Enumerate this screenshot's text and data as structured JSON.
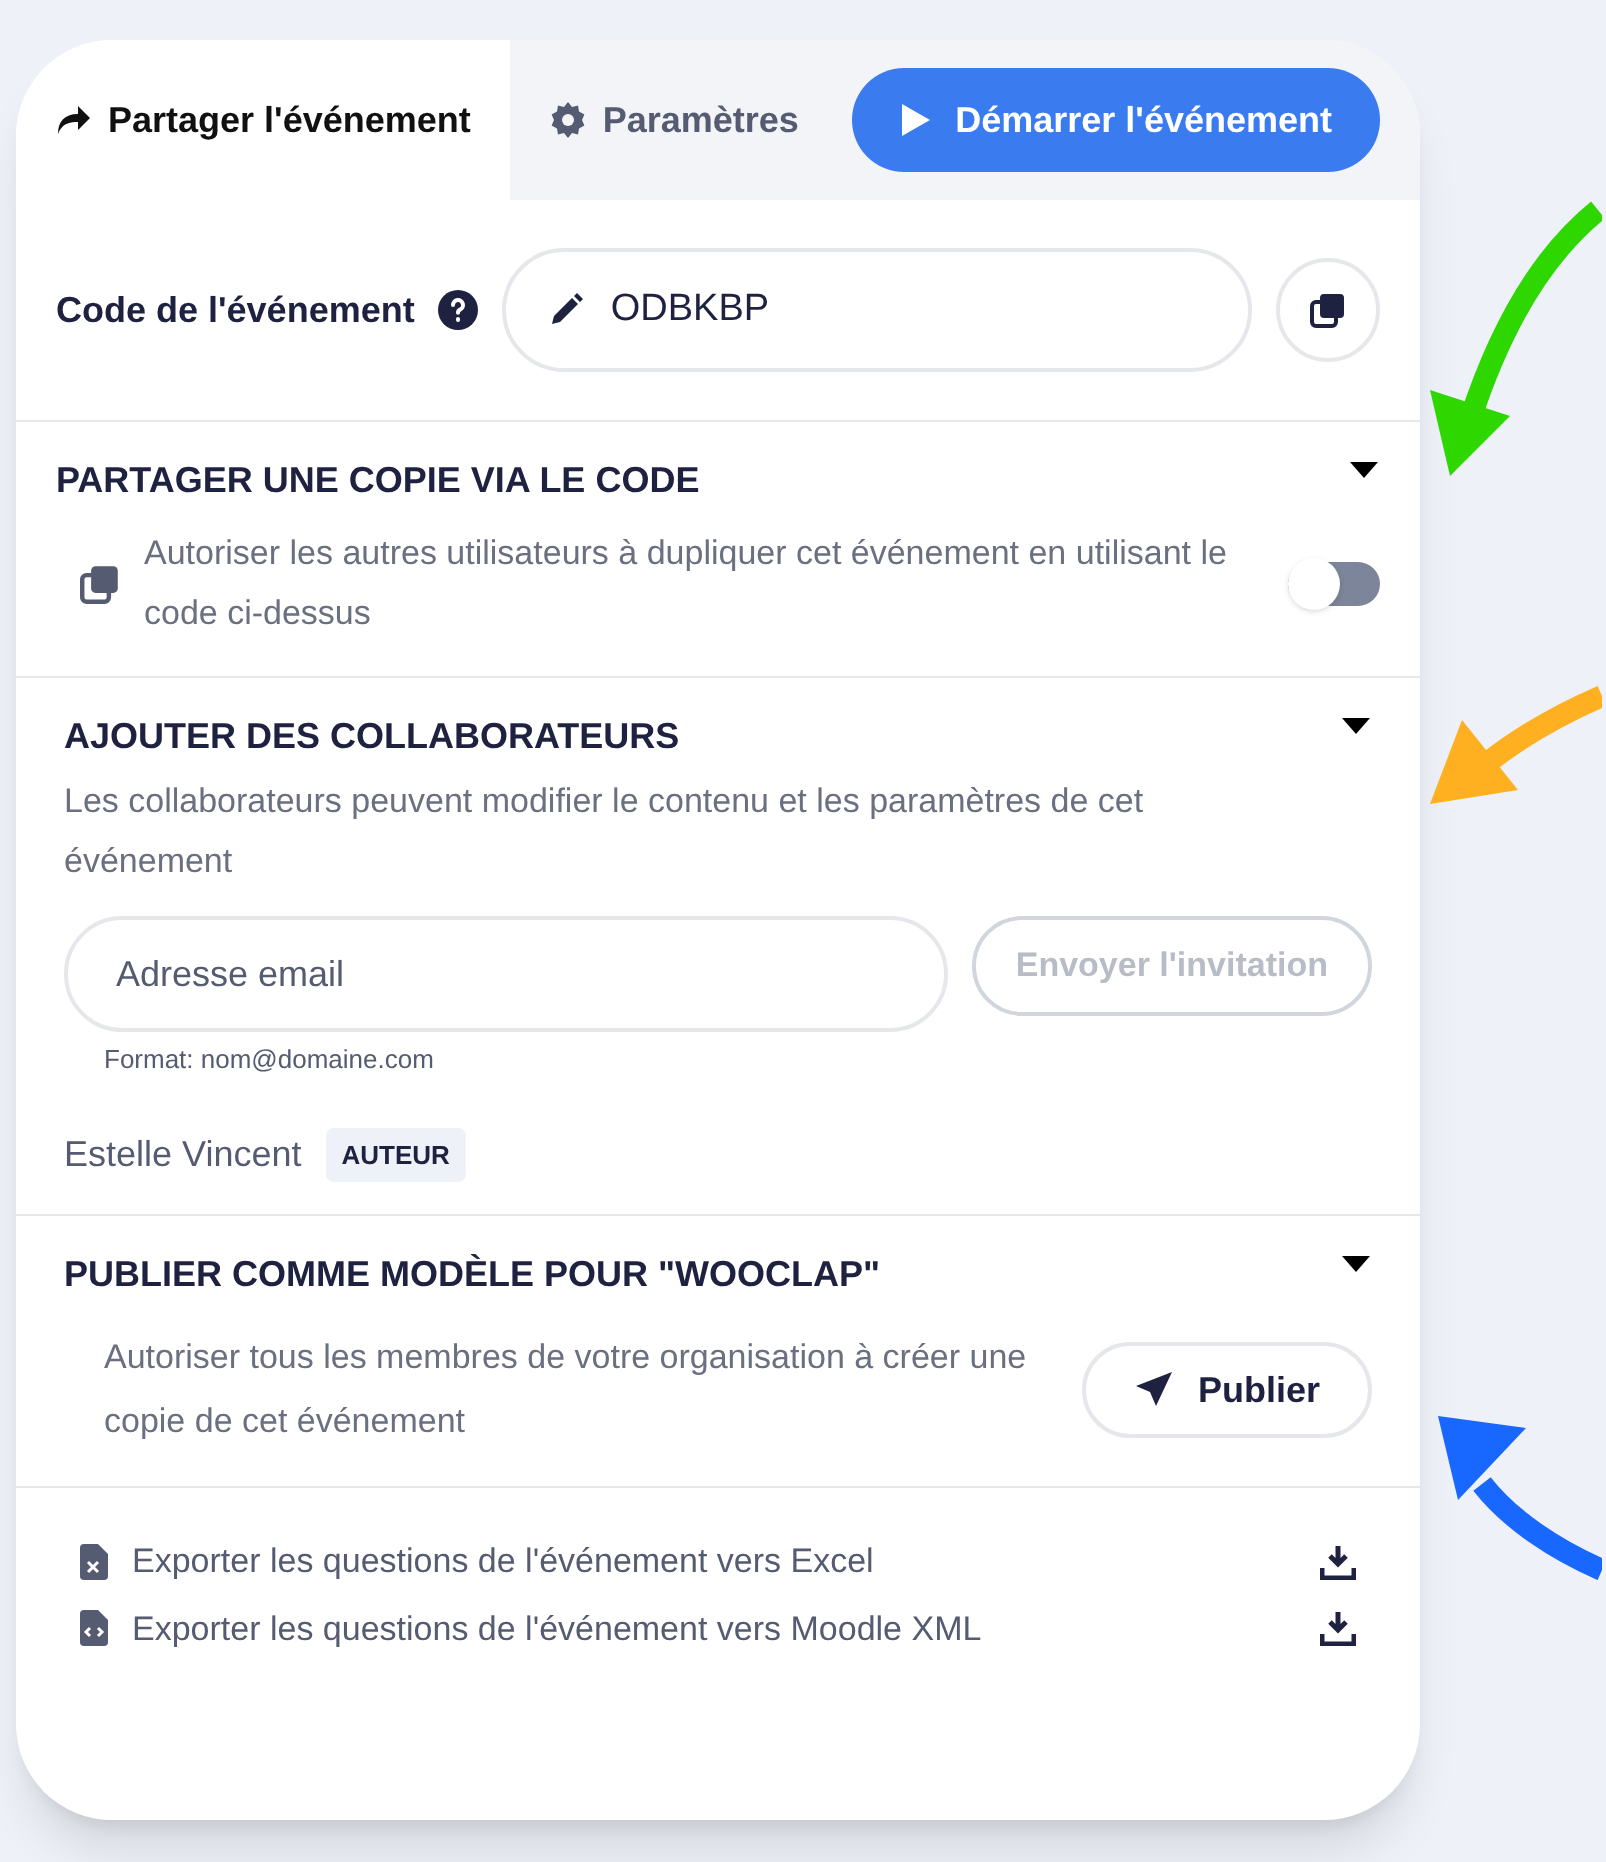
{
  "tabs": [
    {
      "label": "Partager l'événement",
      "selected": true
    },
    {
      "label": "Paramètres",
      "selected": false
    }
  ],
  "start_button": "Démarrer l'événement",
  "event_code": {
    "label": "Code de l'événement",
    "value": "ODBKBP"
  },
  "share_copy": {
    "title": "PARTAGER UNE COPIE VIA LE CODE",
    "description": "Autoriser les autres utilisateurs à dupliquer cet événement en utilisant le code ci-dessus",
    "on": false,
    "expanded": true
  },
  "collaborators": {
    "title": "AJOUTER DES COLLABORATEURS",
    "description": "Les collaborateurs peuvent modifier le contenu et les paramètres de cet événement",
    "email_placeholder": "Adresse email",
    "hint": "Format: nom@domaine.com",
    "invite_button": "Envoyer l'invitation",
    "invite_disabled": true,
    "expanded": true,
    "members": [
      {
        "name": "Estelle Vincent",
        "role": "AUTEUR"
      }
    ]
  },
  "publish": {
    "title": "PUBLIER COMME MODÈLE POUR \"WOOCLAP\"",
    "description": "Autoriser tous les membres de votre organisation à créer une copie de cet événement",
    "button": "Publier",
    "expanded": true
  },
  "exports": [
    {
      "label": "Exporter les questions de l'événement vers Excel",
      "kind": "excel"
    },
    {
      "label": "Exporter les questions de l'événement vers Moodle XML",
      "kind": "code"
    }
  ]
}
